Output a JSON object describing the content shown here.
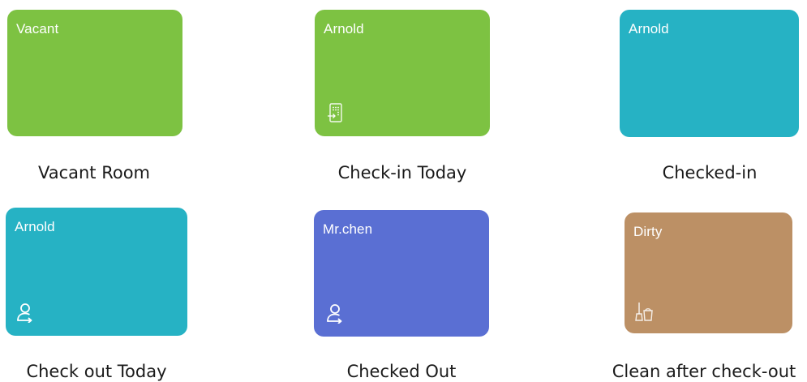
{
  "legend": [
    {
      "tile_name": "Vacant",
      "icon": "none",
      "color": "#7DC242",
      "caption": "Vacant Room"
    },
    {
      "tile_name": "Arnold",
      "icon": "keypad-checkin-icon",
      "color": "#7DC242",
      "caption": "Check-in Today"
    },
    {
      "tile_name": "Arnold",
      "icon": "none",
      "color": "#26B2C4",
      "caption": "Checked-in"
    },
    {
      "tile_name": "Arnold",
      "icon": "guest-checkout-icon",
      "color": "#26B2C4",
      "caption": "Check out Today"
    },
    {
      "tile_name": "Mr.chen",
      "icon": "guest-checkout-icon",
      "color": "#5A6FD3",
      "caption": "Checked Out"
    },
    {
      "tile_name": "Dirty",
      "icon": "cleaning-icon",
      "color": "#BC9065",
      "caption": "Clean after check-out"
    }
  ]
}
